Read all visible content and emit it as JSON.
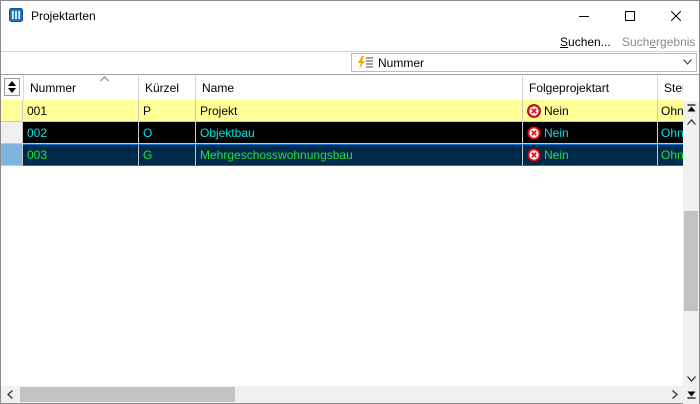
{
  "window": {
    "title": "Projektarten",
    "icon": "grid-app-icon"
  },
  "toolbar": {
    "search_prefix": "S",
    "search_mid": "uchen...",
    "results_prefix": "Such",
    "results_u": "e",
    "results_suffix": "rgebnis"
  },
  "sort": {
    "selected": "Nummer"
  },
  "table": {
    "columns": [
      "Nummer",
      "Kürzel",
      "Name",
      "Folgeprojektart",
      "Steuer"
    ],
    "rows": [
      {
        "nummer": "001",
        "kuerzel": "P",
        "name": "Projekt",
        "folge": "Nein",
        "steuer": "Ohne"
      },
      {
        "nummer": "002",
        "kuerzel": "O",
        "name": "Objektbau",
        "folge": "Nein",
        "steuer": "Ohne"
      },
      {
        "nummer": "003",
        "kuerzel": "G",
        "name": "Mehrgeschosswohnungsbau",
        "folge": "Nein",
        "steuer": "Ohne"
      }
    ]
  },
  "colors": {
    "row1_bg": "#ffff99",
    "row2_bg": "#000000",
    "row2_text": "#00e5e5",
    "row3_bg": "#002a4a",
    "row3_text": "#22e03a",
    "select_blue": "#0078d7",
    "nein_red": "#e81123"
  }
}
